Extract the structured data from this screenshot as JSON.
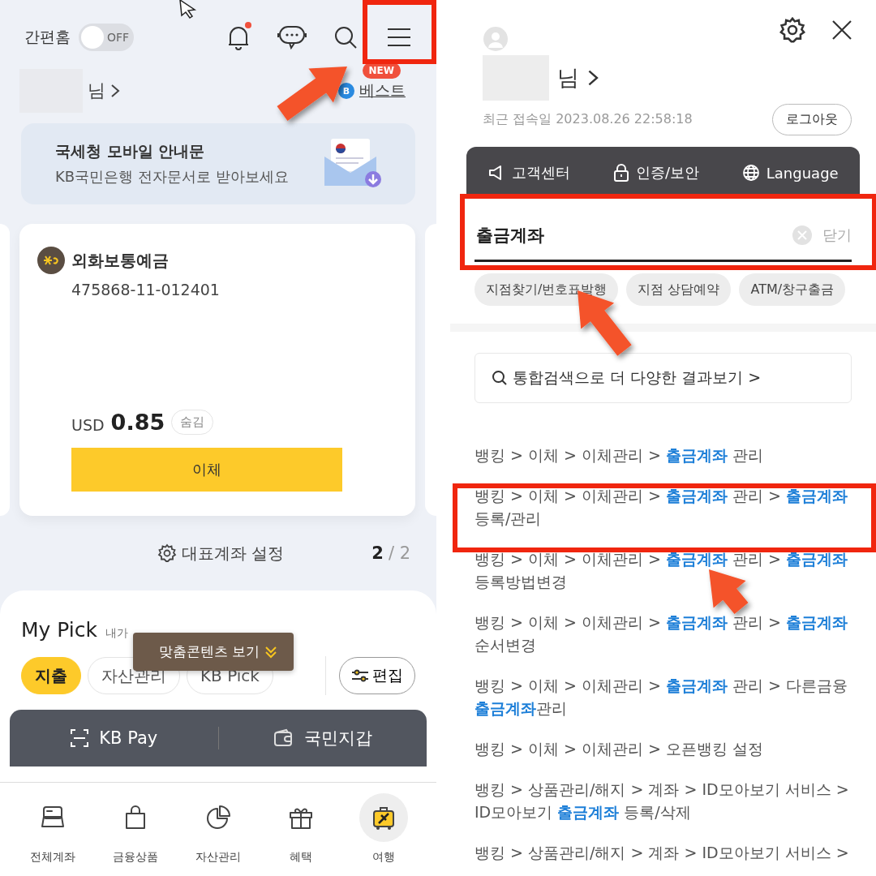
{
  "home": {
    "quick_home": {
      "label": "간편홈",
      "on": false,
      "state_label": "OFF"
    },
    "notification_unread": true,
    "greeting": "님",
    "best": {
      "badge": "NEW",
      "letter": "B",
      "label": "베스트"
    },
    "banner": {
      "title": "국세청 모바일 안내문",
      "subtitle": "KB국민은행 전자문서로 받아보세요"
    },
    "account": {
      "name": "외화보통예금",
      "number": "475868-11-012401",
      "currency": "USD",
      "balance": "0.85",
      "hide_label": "숨김",
      "transfer": "이체"
    },
    "main_account_setting": "대표계좌 설정",
    "pager": {
      "current": "2",
      "rest": "/ 2"
    },
    "my_pick": {
      "title": "My Pick",
      "subtitle": "내가",
      "tooltip": "맞춤콘텐츠 보기",
      "edit": "편집",
      "chips": [
        {
          "label": "지출",
          "selected": true
        },
        {
          "label": "자산관리",
          "selected": false
        },
        {
          "label": "KB Pick",
          "selected": false
        }
      ]
    },
    "pay_bar": [
      {
        "label": "KB Pay",
        "kind": "scan"
      },
      {
        "label": "국민지갑",
        "kind": "wallet"
      }
    ],
    "nav": [
      {
        "label": "전체계좌",
        "kind": "accounts",
        "selected": false
      },
      {
        "label": "금융상품",
        "kind": "products",
        "selected": false
      },
      {
        "label": "자산관리",
        "kind": "assets",
        "selected": false
      },
      {
        "label": "혜택",
        "kind": "benefits",
        "selected": false
      },
      {
        "label": "여행",
        "kind": "travel",
        "selected": true
      }
    ]
  },
  "menu": {
    "greeting": "님",
    "last_login": "최근 접속일 2023.08.26 22:58:18",
    "logout": "로그아웃",
    "shortcuts": [
      {
        "label": "고객센터",
        "kind": "support"
      },
      {
        "label": "인증/보안",
        "kind": "security"
      },
      {
        "label": "Language",
        "kind": "language"
      }
    ],
    "search": {
      "value": "출금계좌",
      "close": "닫기"
    },
    "chips": [
      "지점찾기/번호표발행",
      "지점 상담예약",
      "ATM/창구출금"
    ],
    "more_results": "통합검색으로 더 다양한 결과보기 >",
    "results": [
      "뱅킹 > 이체 > 이체관리 > **출금계좌** 관리",
      "뱅킹 > 이체 > 이체관리 > **출금계좌** 관리 > **출금계좌** 등록/관리",
      "뱅킹 > 이체 > 이체관리 > **출금계좌** 관리 > **출금계좌** 등록방법변경",
      "뱅킹 > 이체 > 이체관리 > **출금계좌** 관리 > **출금계좌** 순서변경",
      "뱅킹 > 이체 > 이체관리 > **출금계좌** 관리 > 다른금융 **출금계좌**관리",
      "뱅킹 > 이체 > 이체관리 > 오픈뱅킹 설정",
      "뱅킹 > 상품관리/해지 > 계좌 > ID모아보기 서비스 > ID모아보기 **출금계좌** 등록/삭제",
      "뱅킹 > 상품관리/해지 > 계좌 > ID모아보기 서비스 >"
    ]
  }
}
